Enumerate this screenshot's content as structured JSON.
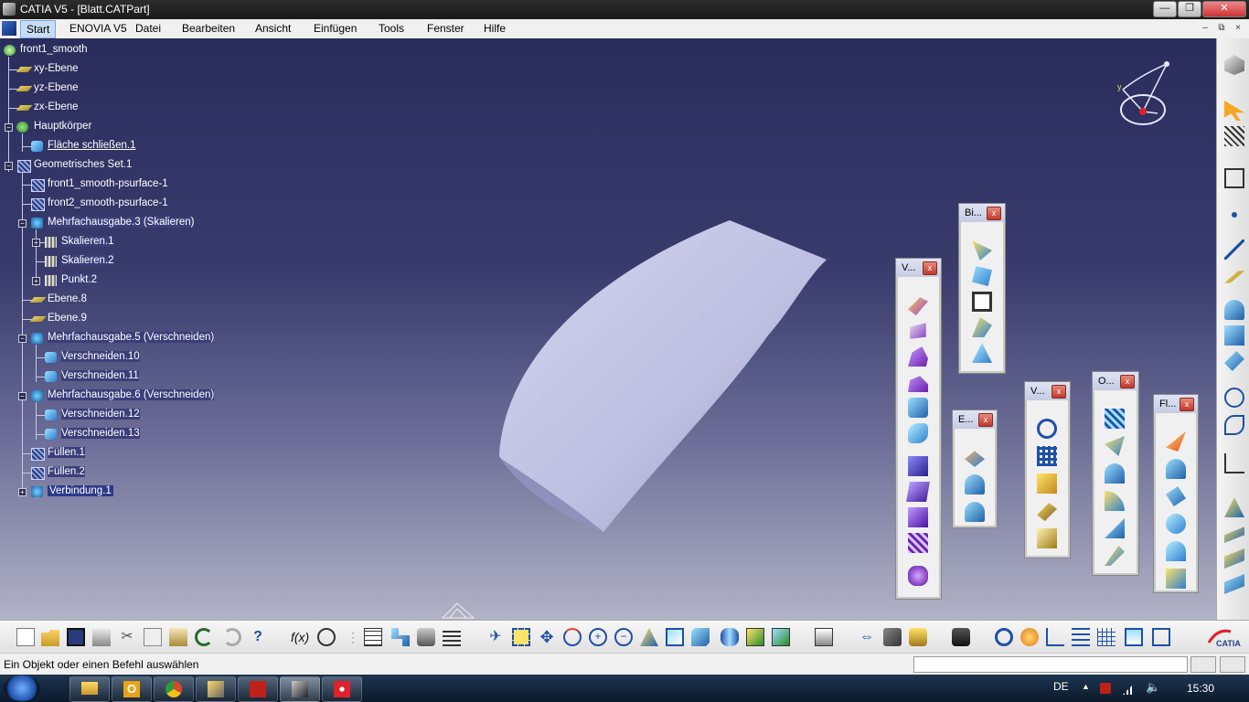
{
  "window": {
    "title": "CATIA V5 - [Blatt.CATPart]",
    "minimize": "—",
    "restore": "❐",
    "close": "✕"
  },
  "menu": {
    "items": [
      "Start",
      "ENOVIA V5",
      "Datei",
      "Bearbeiten",
      "Ansicht",
      "Einfügen",
      "Tools",
      "Fenster",
      "Hilfe"
    ],
    "mdi_min": "–",
    "mdi_restore": "⧉",
    "mdi_close": "×"
  },
  "tree": {
    "root": "front1_smooth",
    "items": [
      {
        "label": "xy-Ebene",
        "icon": "plane-icon"
      },
      {
        "label": "yz-Ebene",
        "icon": "plane-icon"
      },
      {
        "label": "zx-Ebene",
        "icon": "plane-icon"
      },
      {
        "label": "Hauptkörper",
        "icon": "body-icon"
      },
      {
        "label": "Fläche schließen.1",
        "icon": "close-surface-icon"
      },
      {
        "label": "Geometrisches Set.1",
        "icon": "geometrical-set-icon"
      },
      {
        "label": "front1_smooth-psurface-1",
        "icon": "surface-icon"
      },
      {
        "label": "front2_smooth-psurface-1",
        "icon": "surface-icon"
      },
      {
        "label": "Mehrfachausgabe.3 (Skalieren)",
        "icon": "multi-output-icon"
      },
      {
        "label": "Skalieren.1",
        "icon": "scale-icon"
      },
      {
        "label": "Skalieren.2",
        "icon": "scale-icon"
      },
      {
        "label": "Punkt.2",
        "icon": "point-icon"
      },
      {
        "label": "Ebene.8",
        "icon": "plane-icon"
      },
      {
        "label": "Ebene.9",
        "icon": "plane-icon"
      },
      {
        "label": "Mehrfachausgabe.5 (Verschneiden)",
        "icon": "multi-output-icon"
      },
      {
        "label": "Verschneiden.10",
        "icon": "intersect-icon"
      },
      {
        "label": "Verschneiden.11",
        "icon": "intersect-icon"
      },
      {
        "label": "Mehrfachausgabe.6 (Verschneiden)",
        "icon": "multi-output-icon"
      },
      {
        "label": "Verschneiden.12",
        "icon": "intersect-icon"
      },
      {
        "label": "Verschneiden.13",
        "icon": "intersect-icon"
      },
      {
        "label": "Füllen.1",
        "icon": "fill-icon"
      },
      {
        "label": "Füllen.2",
        "icon": "fill-icon"
      },
      {
        "label": "Verbindung.1",
        "icon": "join-icon"
      }
    ]
  },
  "compass": {
    "y_label": "y"
  },
  "toolbars": {
    "v1": {
      "title": "V...",
      "close": "x"
    },
    "bi": {
      "title": "Bi...",
      "close": "x"
    },
    "e": {
      "title": "E...",
      "close": "x"
    },
    "v2": {
      "title": "V...",
      "close": "x"
    },
    "o": {
      "title": "O...",
      "close": "x"
    },
    "fl": {
      "title": "Fl...",
      "close": "x"
    }
  },
  "status": {
    "message": "Ein Objekt oder einen Befehl auswählen"
  },
  "taskbar": {
    "language": "DE",
    "time": "15:30"
  },
  "colors": {
    "viewport_top": "#2a2d5c",
    "viewport_bottom": "#b2b3c6",
    "surface": "#c5c6e6"
  }
}
